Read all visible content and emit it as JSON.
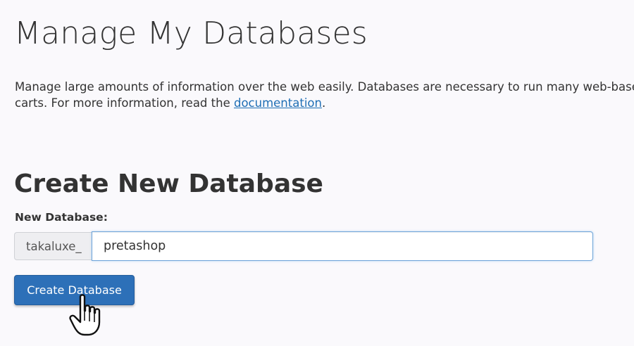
{
  "page": {
    "title": "Manage My Databases",
    "description": {
      "line1": "Manage large amounts of information over the web easily. Databases are necessary to run many web-base",
      "line2_prefix": "carts. For more information, read the ",
      "link_text": "documentation",
      "line2_suffix": "."
    }
  },
  "create_section": {
    "title": "Create New Database",
    "field_label": "New Database:",
    "prefix": "takaluxe_",
    "input_value": "pretashop",
    "button_label": "Create Database"
  },
  "cursor": {
    "icon": "hand-pointer-icon"
  },
  "colors": {
    "button_bg": "#2d70b8",
    "link": "#1f6fb5",
    "input_focus_border": "#6fa4d9"
  }
}
